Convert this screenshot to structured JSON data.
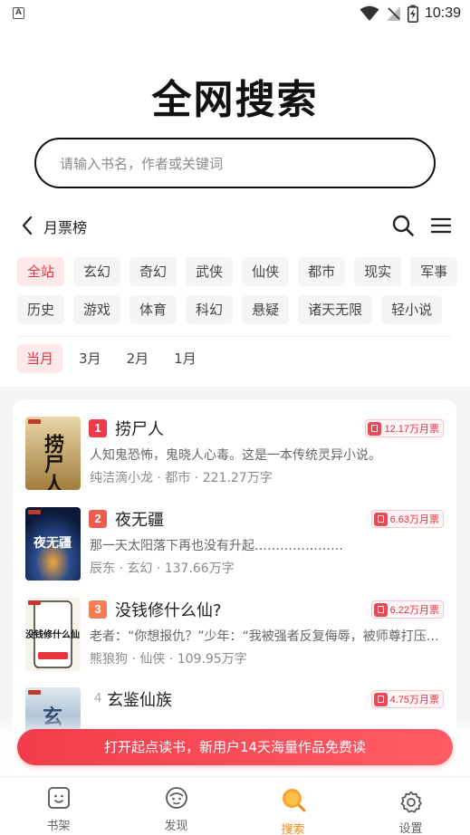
{
  "status_bar": {
    "time": "10:39",
    "notification_icon": "a-icon"
  },
  "brand": {
    "title": "全网搜索"
  },
  "search": {
    "placeholder": "请输入书名，作者或关键词"
  },
  "ranking": {
    "title": "月票榜",
    "categories_row1": [
      "全站",
      "玄幻",
      "奇幻",
      "武侠",
      "仙侠",
      "都市",
      "现实",
      "军事"
    ],
    "categories_row2": [
      "历史",
      "游戏",
      "体育",
      "科幻",
      "悬疑",
      "诸天无限",
      "轻小说"
    ],
    "active_category": "全站",
    "months": [
      "当月",
      "3月",
      "2月",
      "1月"
    ],
    "active_month": "当月"
  },
  "books": [
    {
      "rank": "1",
      "title": "捞尸人",
      "desc": "人知鬼恐怖，鬼晓人心毒。这是一本传统灵异小说。",
      "author": "纯洁滴小龙",
      "genre": "都市",
      "words": "221.27万字",
      "votes": "12.17万月票",
      "cover_text": "捞尸人"
    },
    {
      "rank": "2",
      "title": "夜无疆",
      "desc": "那一天太阳落下再也没有升起…………………",
      "author": "辰东",
      "genre": "玄幻",
      "words": "137.66万字",
      "votes": "6.63万月票",
      "cover_text": "夜无疆"
    },
    {
      "rank": "3",
      "title": "没钱修什么仙?",
      "desc": "老者：“你想报仇？”少年：“我被强者反复侮辱，被师尊打压，被宗门放弃”",
      "author": "熊狼狗",
      "genre": "仙侠",
      "words": "109.95万字",
      "votes": "6.22万月票",
      "cover_text": "没钱修什么仙"
    },
    {
      "rank": "4",
      "title": "玄鉴仙族",
      "votes": "4.75万月票",
      "cover_text": "玄"
    }
  ],
  "colors": {
    "accent": "#e8323e",
    "rank1": "#f0394a",
    "rank2": "#f35a4f",
    "rank3": "#f57d52",
    "tab_active": "#f08a1c"
  },
  "promo": {
    "text": "打开起点读书，新用户14天海量作品免费读"
  },
  "tabs": [
    {
      "label": "书架",
      "icon": "bookshelf-icon"
    },
    {
      "label": "发现",
      "icon": "discover-icon"
    },
    {
      "label": "搜索",
      "icon": "search-tab-icon",
      "active": true
    },
    {
      "label": "设置",
      "icon": "settings-icon"
    }
  ]
}
